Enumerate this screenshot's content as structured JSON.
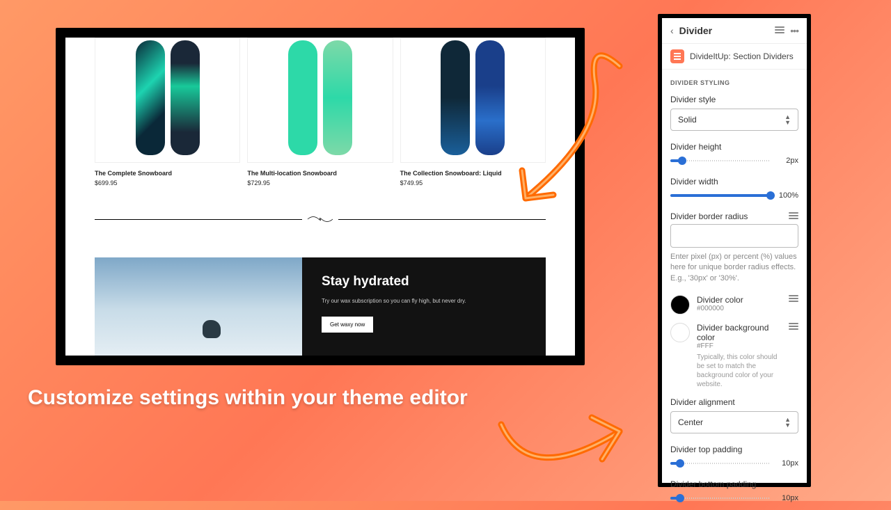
{
  "tagline": "Customize settings within your theme editor",
  "preview": {
    "products": [
      {
        "name": "The Complete Snowboard",
        "price": "$699.95"
      },
      {
        "name": "The Multi-location Snowboard",
        "price": "$729.95"
      },
      {
        "name": "The Collection Snowboard: Liquid",
        "price": "$749.95"
      }
    ],
    "hero": {
      "title": "Stay hydrated",
      "body": "Try our wax subscription so you can fly high, but never dry.",
      "button": "Get waxy now"
    }
  },
  "panel": {
    "title": "Divider",
    "app_name": "DivideItUp: Section Dividers",
    "section_label": "DIVIDER STYLING",
    "fields": {
      "style": {
        "label": "Divider style",
        "value": "Solid"
      },
      "height": {
        "label": "Divider height",
        "value": "2px",
        "percent": 12
      },
      "width": {
        "label": "Divider width",
        "value": "100%",
        "percent": 100
      },
      "border_radius": {
        "label": "Divider border radius",
        "helper": "Enter pixel (px) or percent (%) values here for unique border radius effects. E.g., '30px' or '30%'."
      },
      "color": {
        "label": "Divider color",
        "hex": "#000000"
      },
      "bg_color": {
        "label": "Divider background color",
        "hex": "#FFF",
        "helper": "Typically, this color should be set to match the background color of your website."
      },
      "alignment": {
        "label": "Divider alignment",
        "value": "Center"
      },
      "top_padding": {
        "label": "Divider top padding",
        "value": "10px",
        "percent": 10
      },
      "bottom_padding": {
        "label": "Divider bottom padding",
        "value": "10px",
        "percent": 10
      }
    }
  }
}
